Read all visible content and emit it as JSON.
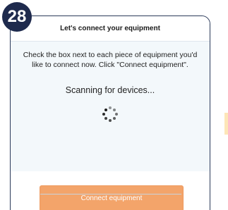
{
  "step_number": "28",
  "dialog": {
    "title": "Let's connect your equipment",
    "instructions": "Check the box next to each piece of equipment you'd like to connect now. Click \"Connect equipment\".",
    "status": "Scanning for devices...",
    "connect_button_label": "Connect equipment"
  },
  "colors": {
    "badge": "#1e2a4d",
    "panel_border": "#2b3a5a",
    "body_background": "#f3f8fb",
    "button": "#f3a46a",
    "side_accent": "#fde6b8"
  },
  "icons": {
    "spinner": "loading-spinner-icon"
  }
}
